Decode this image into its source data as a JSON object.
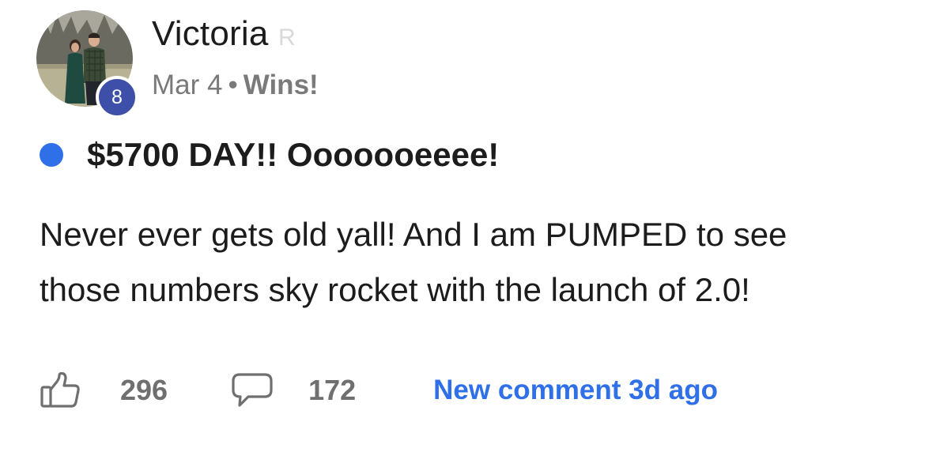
{
  "post": {
    "author": {
      "name": "Victoria",
      "surname_faded": "R",
      "level": "8"
    },
    "meta": {
      "date": "Mar 4",
      "separator": "•",
      "category": "Wins!"
    },
    "title": "$5700 DAY!! Ooooooeeee!",
    "body_lines": [
      "Never ever gets old yall! And I am PUMPED to see",
      "those numbers sky rocket with the launch of 2.0!"
    ],
    "footer": {
      "likes": "296",
      "comments": "172",
      "new_comment_link": "New comment 3d ago"
    },
    "colors": {
      "accent_blue": "#2f6fe8",
      "badge_navy": "#3d4fa8",
      "meta_gray": "#7a7a7a"
    },
    "icons": {
      "like": "thumbs-up-icon",
      "comment": "speech-bubble-icon",
      "unread": "unread-dot-icon"
    }
  }
}
